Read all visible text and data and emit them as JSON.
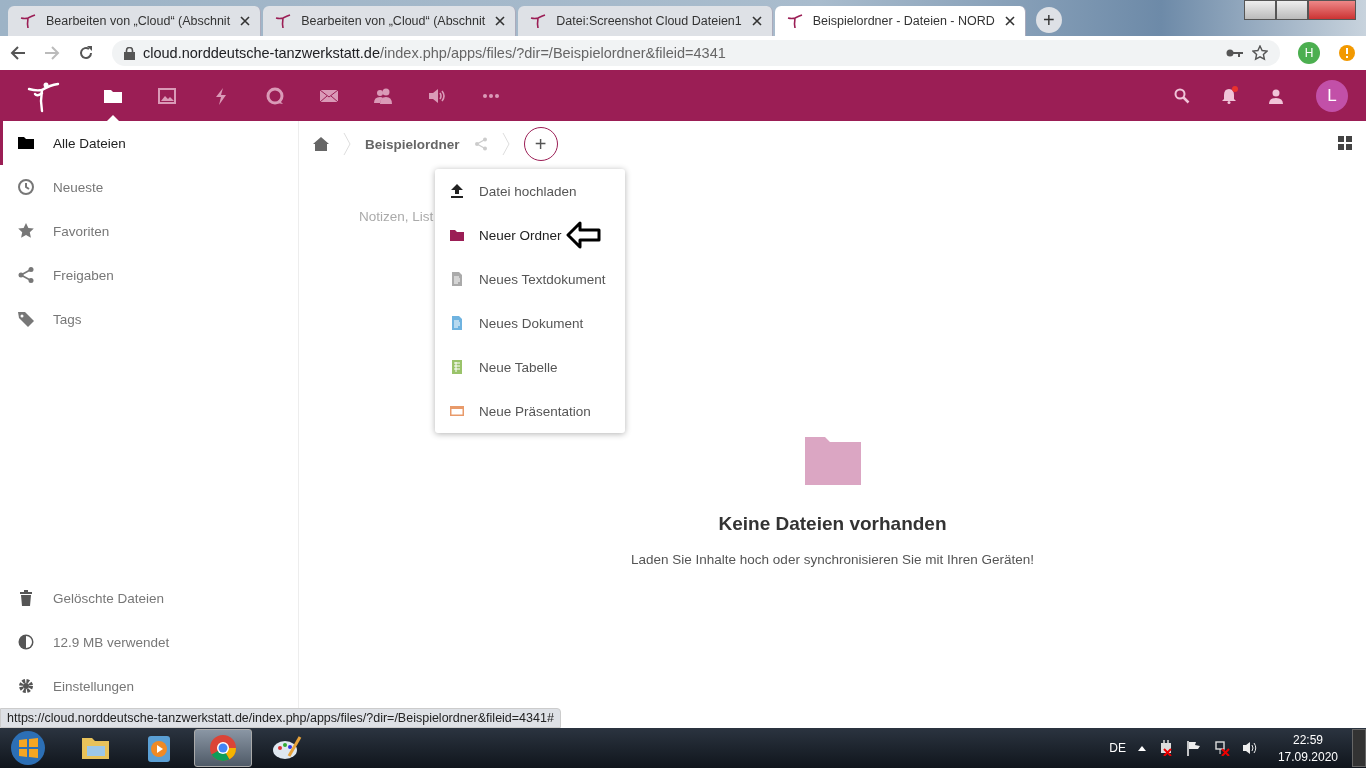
{
  "browser": {
    "tabs": [
      {
        "title": "Bearbeiten von „Cloud“ (Abschnit",
        "selected": false
      },
      {
        "title": "Bearbeiten von „Cloud“ (Abschnit",
        "selected": false
      },
      {
        "title": "Datei:Screenshot Cloud Dateien1",
        "selected": false
      },
      {
        "title": "Beispielordner - Dateien - NORD",
        "selected": true
      }
    ],
    "new_tab": "+",
    "url_host": "cloud.norddeutsche-tanzwerkstatt.de",
    "url_path": "/index.php/apps/files/?dir=/Beispielordner&fileid=4341",
    "profile_initial": "H"
  },
  "header": {
    "apps": [
      {
        "kind": "files",
        "selected": true
      },
      {
        "kind": "photos",
        "selected": false
      },
      {
        "kind": "activity",
        "selected": false
      },
      {
        "kind": "talk",
        "selected": false
      },
      {
        "kind": "mail",
        "selected": false
      },
      {
        "kind": "contacts",
        "selected": false
      },
      {
        "kind": "audio",
        "selected": false
      },
      {
        "kind": "more",
        "selected": false
      }
    ],
    "notification": true,
    "avatar_initial": "L"
  },
  "sidebar": {
    "items": [
      {
        "kind": "folder",
        "label": "Alle Dateien",
        "selected": true
      },
      {
        "kind": "recent",
        "label": "Neueste",
        "selected": false
      },
      {
        "kind": "star",
        "label": "Favoriten",
        "selected": false
      },
      {
        "kind": "share",
        "label": "Freigaben",
        "selected": false
      },
      {
        "kind": "tag",
        "label": "Tags",
        "selected": false
      }
    ],
    "bottom_items": [
      {
        "kind": "trash",
        "label": "Gelöschte Dateien"
      },
      {
        "kind": "quota",
        "label": "12.9 MB verwendet"
      },
      {
        "kind": "settings",
        "label": "Einstellungen"
      }
    ]
  },
  "breadcrumb": {
    "folder": "Beispielordner",
    "add_button": "+"
  },
  "hint_text": "Notizen, List",
  "new_menu": {
    "items": [
      {
        "kind": "upload",
        "label": "Datei hochladen"
      },
      {
        "kind": "folder",
        "label": "Neuer Ordner"
      },
      {
        "kind": "text",
        "label": "Neues Textdokument"
      },
      {
        "kind": "document",
        "label": "Neues Dokument"
      },
      {
        "kind": "spreadsheet",
        "label": "Neue Tabelle"
      },
      {
        "kind": "presentation",
        "label": "Neue Präsentation"
      }
    ]
  },
  "empty_state": {
    "title": "Keine Dateien vorhanden",
    "text": "Laden Sie Inhalte hoch oder synchronisieren Sie mit Ihren Geräten!"
  },
  "status_url": "https://cloud.norddeutsche-tanzwerkstatt.de/index.php/apps/files/?dir=/Beispielordner&fileid=4341#",
  "taskbar": {
    "apps": [
      {
        "kind": "explorer",
        "selected": false
      },
      {
        "kind": "media",
        "selected": false
      },
      {
        "kind": "chrome",
        "selected": true
      },
      {
        "kind": "paint",
        "selected": false
      }
    ],
    "language": "DE",
    "time": "22:59",
    "date": "17.09.2020"
  }
}
